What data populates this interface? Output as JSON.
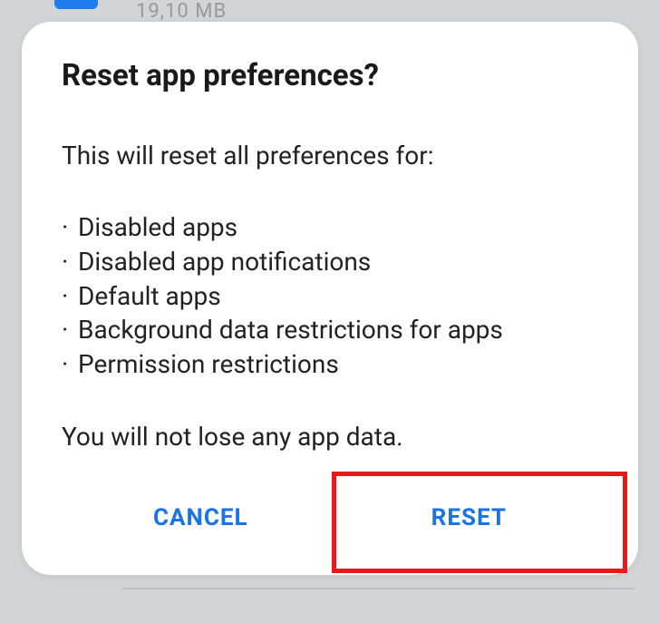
{
  "background": {
    "partial_text": "19,10 MB"
  },
  "dialog": {
    "title": "Reset app preferences?",
    "intro": "This will reset all preferences for:",
    "bullets": [
      "Disabled apps",
      "Disabled app notifications",
      "Default apps",
      "Background data restrictions for apps",
      "Permission restrictions"
    ],
    "footnote": "You will not lose any app data.",
    "cancel_label": "CANCEL",
    "reset_label": "RESET"
  }
}
